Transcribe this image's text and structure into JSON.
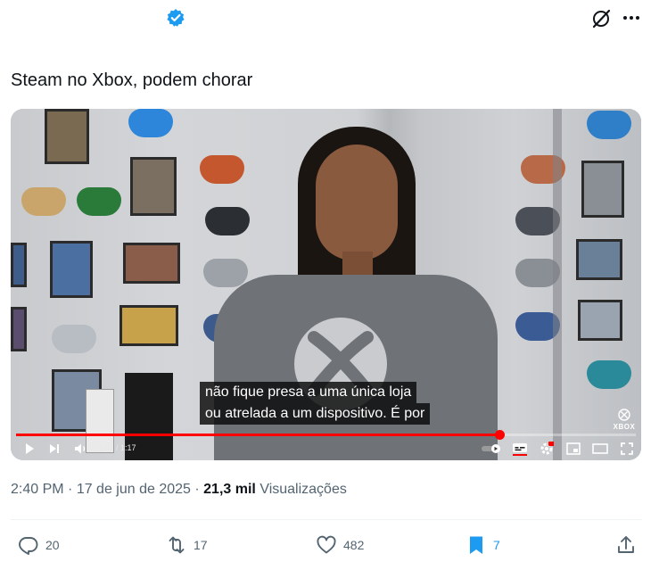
{
  "tweet": {
    "text": "Steam no Xbox, podem chorar",
    "time": "2:40 PM",
    "separator": " · ",
    "date": "17 de jun de 2025",
    "views_count": "21,3 mil",
    "views_label": "Visualizações"
  },
  "video": {
    "subtitle_line1": "não fique presa a uma única loja",
    "subtitle_line2": "ou atrelada a um dispositivo.  É por",
    "time_display": "1:01 / 1:17",
    "progress_fraction": 0.78,
    "watermark": "XBOX"
  },
  "actions": {
    "replies": "20",
    "reposts": "17",
    "likes": "482",
    "bookmarks": "7"
  },
  "colors": {
    "verified_blue": "#1d9bf0",
    "bookmark_blue": "#1d9bf0",
    "progress_red": "#ff0000",
    "muted_text": "#536471"
  },
  "icons": [
    "verified-badge-icon",
    "grok-icon",
    "more-icon",
    "play-icon",
    "next-icon",
    "volume-icon",
    "autoplay-toggle-icon",
    "captions-icon",
    "settings-icon",
    "miniplayer-icon",
    "theater-icon",
    "fullscreen-icon",
    "reply-icon",
    "repost-icon",
    "like-icon",
    "bookmark-icon",
    "share-icon"
  ]
}
